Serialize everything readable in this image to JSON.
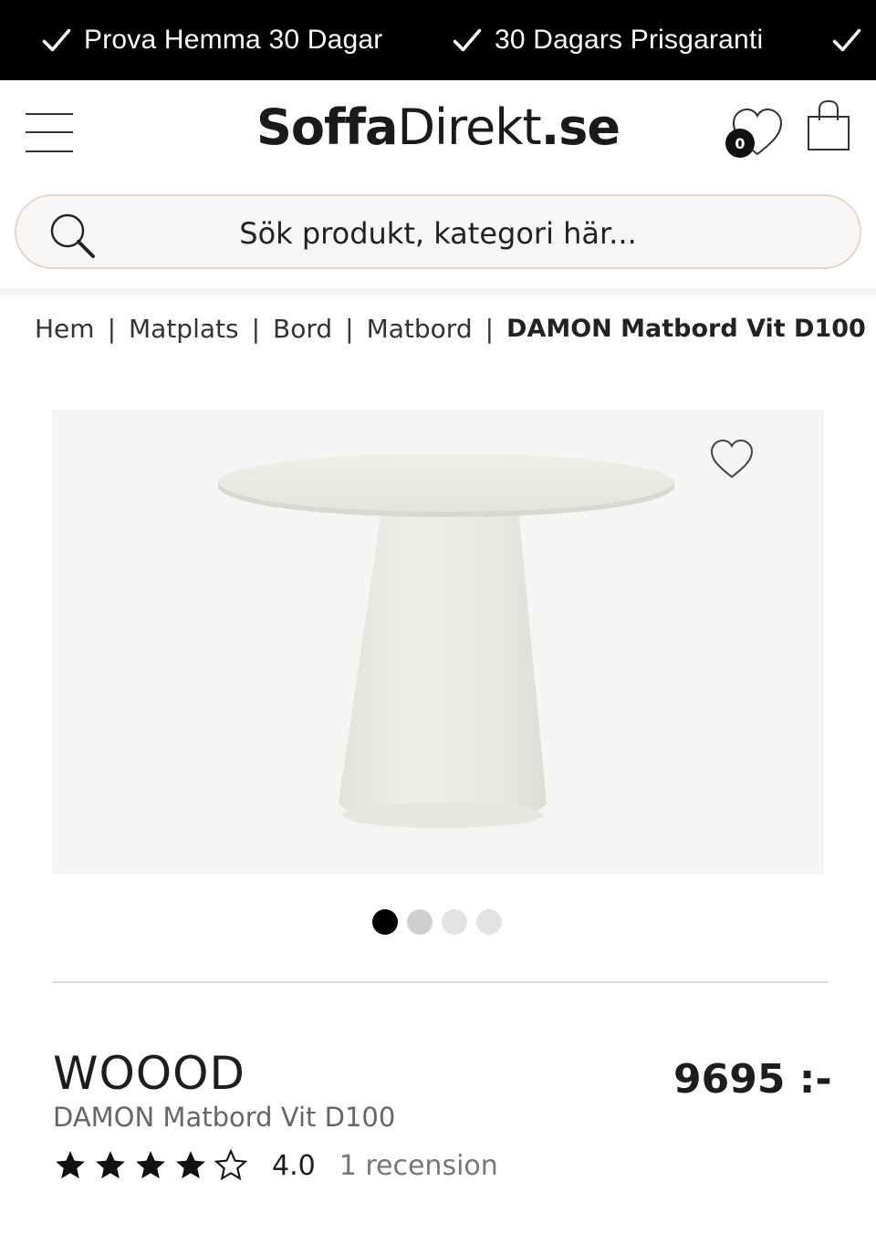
{
  "usp_bar": {
    "items": [
      "Prova Hemma 30 Dagar",
      "30 Dagars Prisgaranti",
      ""
    ]
  },
  "header": {
    "logo_part1": "Soffa",
    "logo_part2": "Direkt",
    "logo_part3": ".se",
    "wishlist_count": "0",
    "search_placeholder": "Sök produkt, kategori här..."
  },
  "breadcrumb": {
    "items": [
      "Hem",
      "Matplats",
      "Bord",
      "Matbord"
    ],
    "separator": "|",
    "current": "DAMON Matbord Vit D100"
  },
  "gallery": {
    "image_count": 4,
    "active_index": 0
  },
  "product": {
    "brand": "WOOOD",
    "name": "DAMON Matbord Vit D100",
    "price": "9695 :-",
    "rating": "4.0",
    "rating_stars": 4,
    "rating_max": 5,
    "reviews": "1 recension"
  },
  "colors": {
    "topbar_bg": "#000000",
    "search_border": "#e4d6cf",
    "image_bg": "#f6f5f3"
  }
}
